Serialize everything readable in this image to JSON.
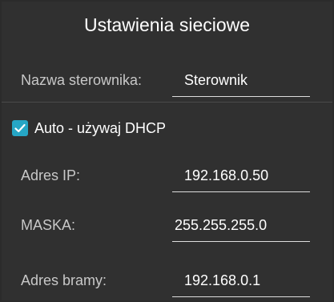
{
  "title": "Ustawienia sieciowe",
  "controller": {
    "label": "Nazwa sterownika:",
    "value": "Sterownik"
  },
  "dhcp": {
    "label": "Auto - używaj DHCP",
    "checked": true
  },
  "ip": {
    "label": "Adres IP:",
    "value": "192.168.0.50"
  },
  "mask": {
    "label": "MASKA:",
    "value": "255.255.255.0"
  },
  "gateway": {
    "label": "Adres bramy:",
    "value": "192.168.0.1"
  },
  "colors": {
    "background": "#303030",
    "accent": "#26a6c5",
    "text": "#ffffff",
    "label_text": "#c8c8c8"
  }
}
